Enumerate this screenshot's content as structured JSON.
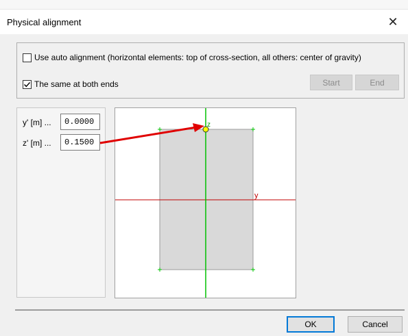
{
  "window": {
    "title": "Physical alignment"
  },
  "options": {
    "auto_alignment": {
      "label": "Use auto alignment (horizontal elements: top of cross-section, all others: center of gravity)",
      "checked": false
    },
    "same_both_ends": {
      "label": "The same at both ends",
      "checked": true
    },
    "start_label": "Start",
    "end_label": "End"
  },
  "fields": {
    "y_label": "y' [m] ...",
    "y_value": "0.0000",
    "z_label": "z' [m] ...",
    "z_value": "0.1500"
  },
  "preview": {
    "axis_y_label": "y",
    "axis_z_label": "z",
    "colors": {
      "axis_y": "#c00000",
      "axis_z": "#00c000",
      "section_fill": "#d9d9d9",
      "point": "#ffff00",
      "arrow": "#e00000"
    }
  },
  "buttons": {
    "ok": "OK",
    "cancel": "Cancel"
  }
}
